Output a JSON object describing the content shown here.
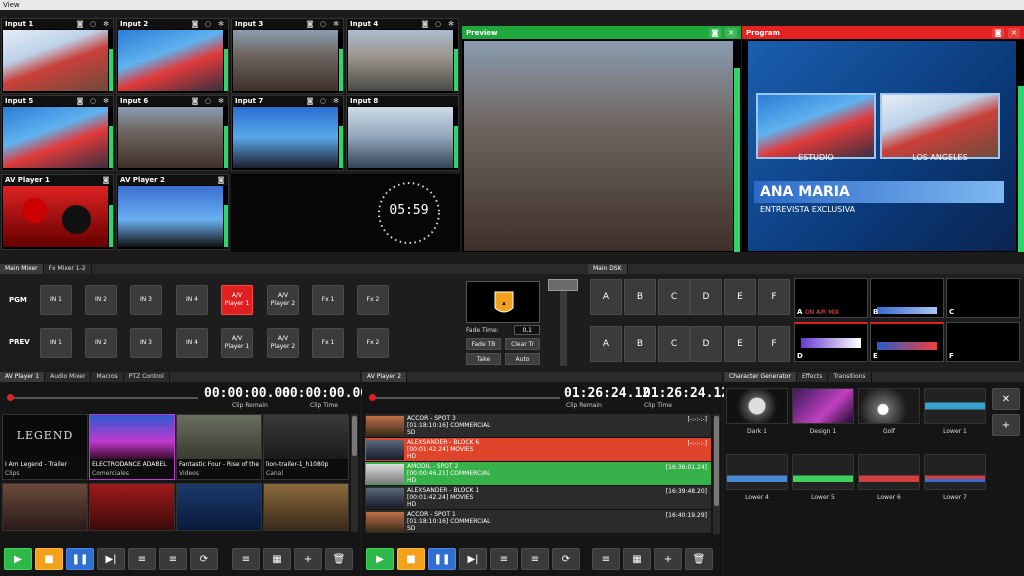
{
  "menu": {
    "view": "View"
  },
  "inputs": [
    {
      "label": "Input 1"
    },
    {
      "label": "Input 2"
    },
    {
      "label": "Input 3"
    },
    {
      "label": "Input 4"
    },
    {
      "label": "Input 5"
    },
    {
      "label": "Input 6"
    },
    {
      "label": "Input 7"
    },
    {
      "label": "Input 8"
    },
    {
      "label": "AV Player 1"
    },
    {
      "label": "AV Player 2"
    }
  ],
  "clock": {
    "time": "05:59"
  },
  "preview": {
    "title": "Preview",
    "color": "#1fa83c"
  },
  "program": {
    "title": "Program",
    "color": "#e52222",
    "box_left": "ESTUDIO",
    "box_right": "LOS ANGELES",
    "name": "ANA MARIA",
    "subtitle": "ENTREVISTA EXCLUSIVA"
  },
  "mixer": {
    "tabs": [
      "Main Mixer",
      "Fx Mixer 1-2"
    ],
    "pgm_label": "PGM",
    "prev_label": "PREV",
    "buttons": [
      "IN 1",
      "IN 2",
      "IN 3",
      "IN 4",
      "A/V\nPlayer 1",
      "A/V\nPlayer 2",
      "Fx 1",
      "Fx 2"
    ],
    "fade_time_label": "Fade Time:",
    "fade_time_value": "0,1",
    "fade_tb": "Fade TB",
    "clear_tr": "Clear Tr",
    "take": "Take",
    "auto": "Auto"
  },
  "dsk": {
    "tab": "Main DSK",
    "buttons": [
      "A",
      "B",
      "C",
      "D",
      "E",
      "F"
    ],
    "previews": [
      "A",
      "B",
      "C",
      "D",
      "E",
      "F"
    ],
    "preview_a_text": "ON AIR MIX"
  },
  "player1": {
    "tabs": [
      "AV Player 1",
      "Audio Mixer",
      "Macros",
      "PTZ Control"
    ],
    "clip_remain": "00:00:00.00",
    "clip_time": "00:00:00.00",
    "clip_remain_label": "Clip Remain",
    "clip_time_label": "Clip Time",
    "clips": [
      {
        "name": "I Am Legend - Trailer",
        "group": "Clips",
        "thumb_text": "LEGEND"
      },
      {
        "name": "ELECTRODANCE ADABEL",
        "group": "Comerciales"
      },
      {
        "name": "Fantastic Four - Rise of the",
        "group": "Videos"
      },
      {
        "name": "lion-trailer-1_h1080p",
        "group": "Canal"
      }
    ]
  },
  "player2": {
    "tab": "AV Player 2",
    "clip_remain": "01:26:24.12",
    "clip_time": "01:26:24.12",
    "clip_remain_label": "Clip Remain",
    "clip_time_label": "Clip Time",
    "playlist": [
      {
        "title": "ACCOR - SPOT 3",
        "info": "[01:18:10:16]  COMMERCIAL",
        "fmt": "SD",
        "time": "[-:-:-:-]",
        "bg": "#2b2b2b"
      },
      {
        "title": "ALEXSANDER - BLOCK 6",
        "info": "[00:01:42.24]  MOVIES",
        "fmt": "HD",
        "time": "[-:-:-:-]",
        "bg": "#e0442a"
      },
      {
        "title": "AMODIL - SPOT 2",
        "info": "[00:00:46.21]  COMMERCIAL",
        "fmt": "HD",
        "time": "[16:36:01.24]",
        "bg": "#37b24a"
      },
      {
        "title": "ALEXSANDER - BLOCK 1",
        "info": "[00:01:42.24]  MOVIES",
        "fmt": "HD",
        "time": "[16:39:48.20]",
        "bg": "#2b2b2b"
      },
      {
        "title": "ACCOR - SPOT 1",
        "info": "[01:18:10:16]  COMMERCIAL",
        "fmt": "SD",
        "time": "[16:40:19.29]",
        "bg": "#2b2b2b"
      }
    ]
  },
  "cg": {
    "tabs": [
      "Character Generator",
      "Effects",
      "Transitions"
    ],
    "items": [
      "Dark 1",
      "Design 1",
      "Golf",
      "Lower 1",
      "Lower 4",
      "Lower 5",
      "Lower 6",
      "Lower 7"
    ]
  },
  "icons": {
    "camera": "◙",
    "circle": "○",
    "gear": "✻",
    "play": "▶",
    "stop": "■",
    "pause": "❚❚",
    "next": "▶|",
    "add": "+",
    "delete": "🗑",
    "loop": "⟳",
    "list": "≡",
    "image": "▦",
    "wrench": "✕"
  }
}
